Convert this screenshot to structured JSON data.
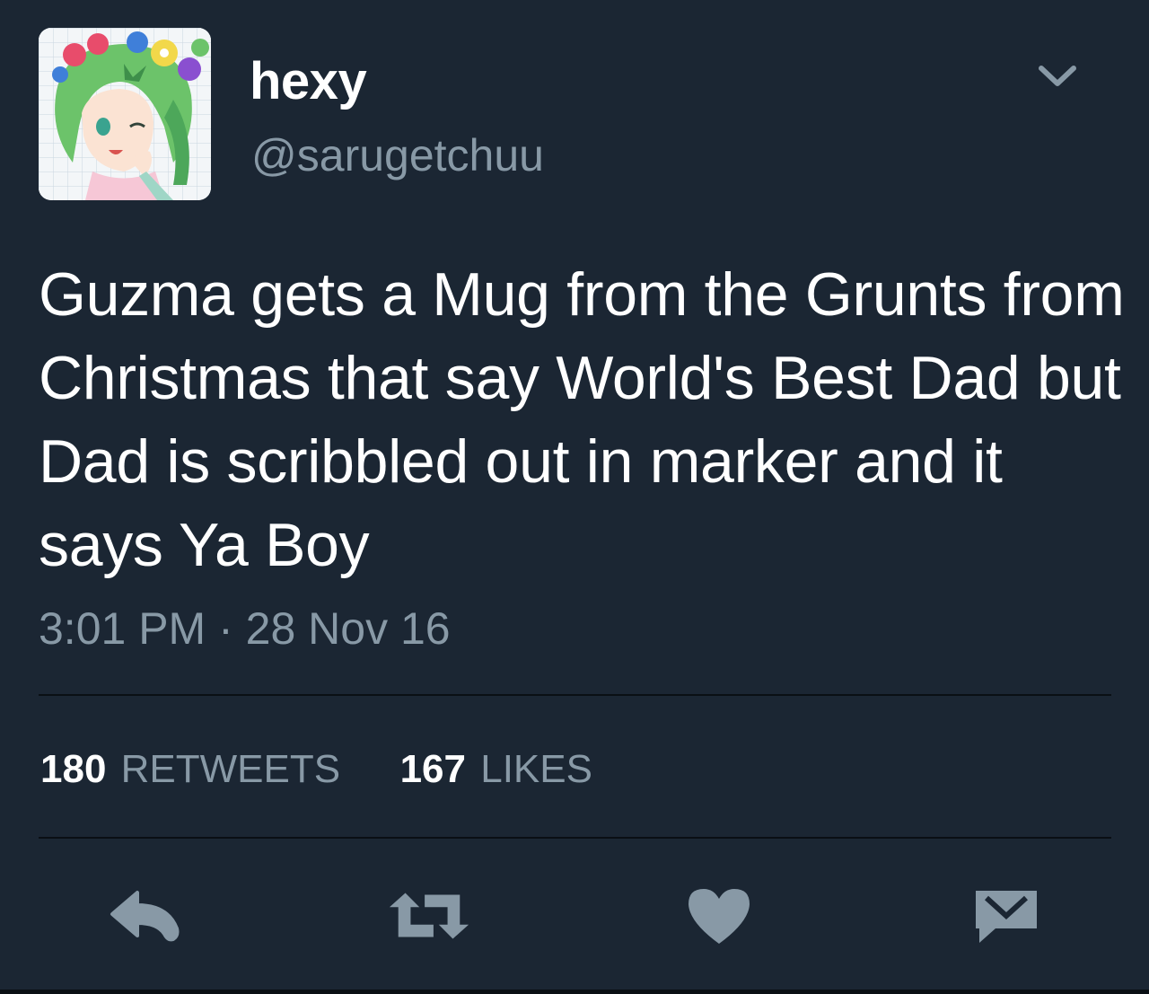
{
  "user": {
    "display_name": "hexy",
    "handle": "@sarugetchuu",
    "avatar_icon": "anime-avatar-icon"
  },
  "tweet": {
    "text": "Guzma gets a Mug from the Grunts from Christmas that say World's Best Dad but Dad is scribbled out in marker and it says Ya Boy",
    "timestamp": "3:01 PM · 28 Nov 16"
  },
  "stats": {
    "retweets_count": "180",
    "retweets_label": "RETWEETS",
    "likes_count": "167",
    "likes_label": "LIKES"
  },
  "actions": {
    "reply_icon": "reply-icon",
    "retweet_icon": "retweet-icon",
    "like_icon": "heart-icon",
    "dm_icon": "envelope-icon"
  },
  "colors": {
    "background": "#1b2633",
    "primary_text": "#ffffff",
    "secondary_text": "#8899a6",
    "icon": "#8899a6",
    "divider": "#0a0f14"
  }
}
